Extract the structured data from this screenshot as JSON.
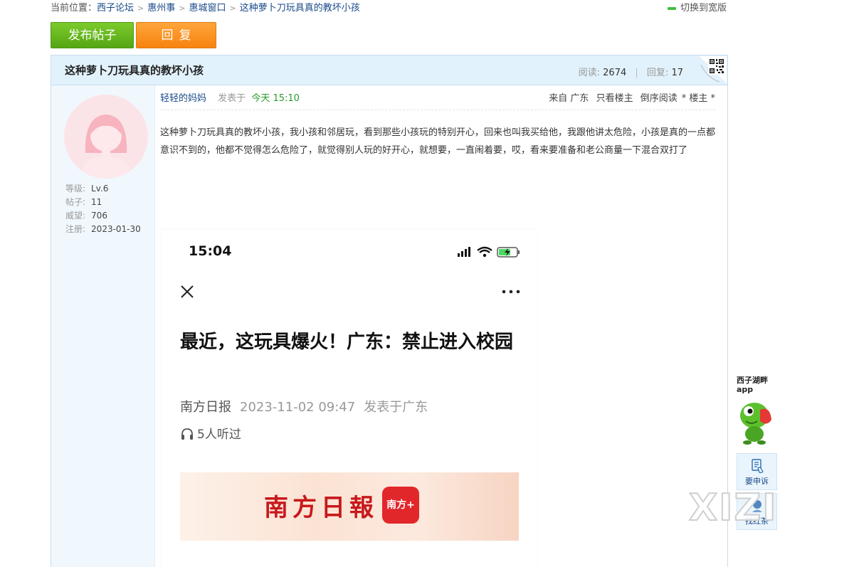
{
  "breadcrumb": {
    "prefix": "当前位置：",
    "items": [
      "西子论坛",
      "惠州事",
      "惠城窗口",
      "这种萝卜刀玩具真的教坏小孩"
    ]
  },
  "wide_toggle": "切换到宽版",
  "buttons": {
    "post": "发布帖子",
    "reply": "回复"
  },
  "thread": {
    "title": "这种萝卜刀玩具真的教坏小孩",
    "views_label": "阅读:",
    "views": "2674",
    "replies_label": "回复:",
    "replies": "17"
  },
  "author": {
    "name": "轻轻的妈妈",
    "info": [
      {
        "label": "等级:",
        "value": "Lv.6"
      },
      {
        "label": "帖子:",
        "value": "11"
      },
      {
        "label": "威望:",
        "value": "706"
      },
      {
        "label": "注册:",
        "value": "2023-01-30"
      }
    ]
  },
  "post": {
    "posted_label": "发表于",
    "posted_time": "今天 15:10",
    "from": "来自 广东",
    "only_op": "只看楼主",
    "reverse": "倒序阅读",
    "floor": "* 楼主 *",
    "body": "这种萝卜刀玩具真的教坏小孩，我小孩和邻居玩，看到那些小孩玩的特别开心，回来也叫我买给他，我跟他讲太危险，小孩是真的一点都意识不到的，他都不觉得怎么危险了，就觉得别人玩的好开心，就想要，一直闹着要，哎，看来要准备和老公商量一下混合双打了"
  },
  "screenshot": {
    "time": "15:04",
    "headline": "最近，这玩具爆火！广东：禁止进入校园",
    "source": "南方日报",
    "date": "2023-11-02 09:47",
    "location": "发表于广东",
    "listened": "5人听过",
    "banner_text": "南方日報",
    "banner_logo": "南方+"
  },
  "sidebar": {
    "app_line1": "西子湖畔",
    "app_line2": "app",
    "complain": "要申诉",
    "find": "找红茶"
  },
  "watermark": "XIZI",
  "colors": {
    "post_button": "#5cae18",
    "reply_button": "#f7891a",
    "header_bg": "#e2f2fc",
    "author_bg": "#f1f8fd"
  }
}
